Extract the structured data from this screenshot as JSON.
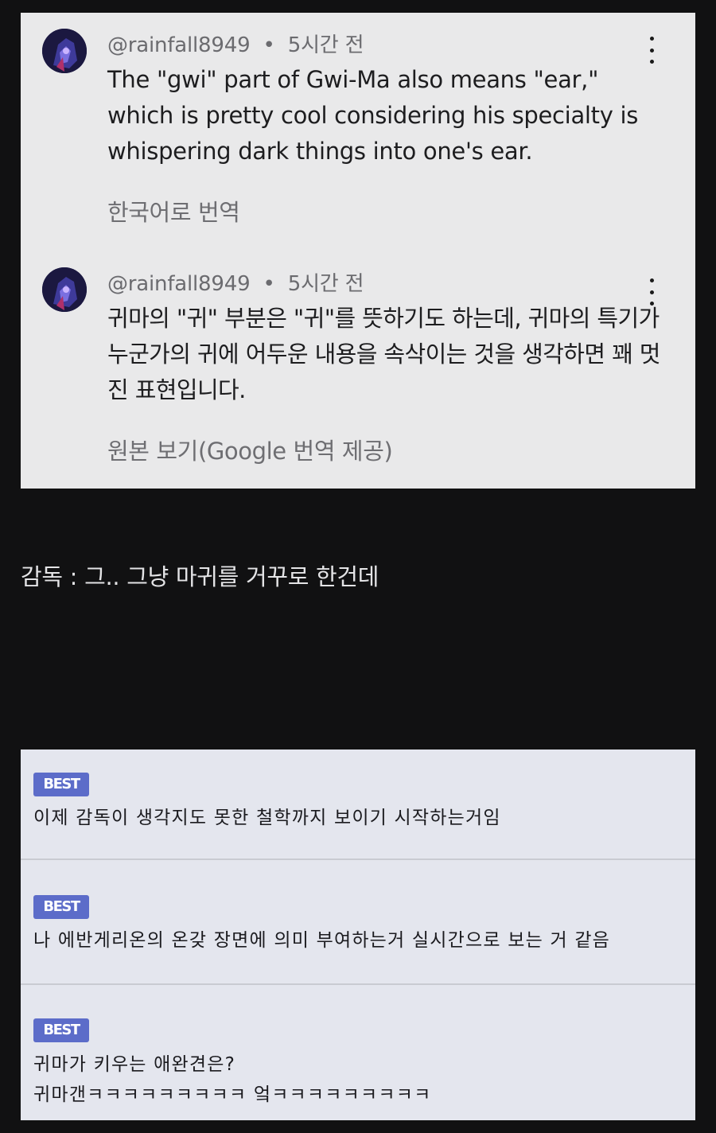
{
  "youtube_comments": [
    {
      "handle": "@rainfall8949",
      "separator": "•",
      "time": "5시간 전",
      "text": "The \"gwi\" part of Gwi-Ma also means \"ear,\" which is pretty cool considering his specialty is whispering dark things into one's ear.",
      "translate_link": "한국어로 번역",
      "avatar_icon": "avatar-image",
      "menu_icon": "more-vert-icon"
    },
    {
      "handle": "@rainfall8949",
      "separator": "•",
      "time": "5시간 전",
      "text": "귀마의 \"귀\" 부분은 \"귀\"를 뜻하기도 하는데, 귀마의 특기가 누군가의 귀에 어두운 내용을 속삭이는 것을 생각하면 꽤 멋진 표현입니다.",
      "translate_link": "원본 보기(Google 번역 제공)",
      "avatar_icon": "avatar-image",
      "menu_icon": "more-vert-icon"
    }
  ],
  "caption": "감독 : 그.. 그냥 마귀를 거꾸로 한건데",
  "best_comments": [
    {
      "badge": "BEST",
      "lines": [
        "이제 감독이 생각지도 못한 철학까지 보이기 시작하는거임"
      ]
    },
    {
      "badge": "BEST",
      "lines": [
        "나 에반게리온의 온갖 장면에 의미 부여하는거 실시간으로 보는 거 같음"
      ]
    },
    {
      "badge": "BEST",
      "lines": [
        "귀마가 키우는 애완견은?",
        "귀마갠ㅋㅋㅋㅋㅋㅋㅋㅋㅋ 엌ㅋㅋㅋㅋㅋㅋㅋㅋㅋ"
      ]
    }
  ],
  "colors": {
    "page_bg": "#111112",
    "yt_panel_bg": "#e9e9ea",
    "best_panel_bg": "#e4e6ee",
    "best_badge": "#5c6cc9"
  }
}
